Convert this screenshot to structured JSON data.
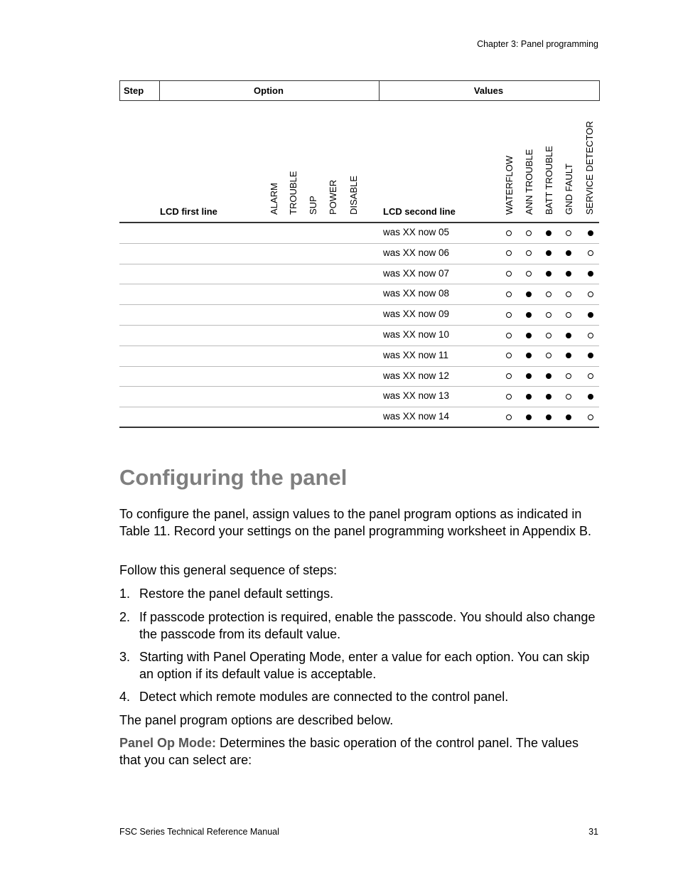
{
  "header": {
    "chapter": "Chapter 3: Panel programming"
  },
  "table": {
    "headers": {
      "step": "Step",
      "option": "Option",
      "values": "Values"
    },
    "subheaders": {
      "lcd_first": "LCD first line",
      "lcd_second": "LCD second line",
      "first_cols": [
        "ALARM",
        "TROUBLE",
        "SUP",
        "POWER",
        "DISABLE"
      ],
      "value_cols": [
        "WATERFLOW",
        "ANN TROUBLE",
        "BATT TROUBLE",
        "GND FAULT",
        "SERVICE DETECTOR"
      ]
    },
    "rows": [
      {
        "lcd2": "was XX now 05",
        "values": [
          0,
          0,
          1,
          0,
          1
        ]
      },
      {
        "lcd2": "was XX now 06",
        "values": [
          0,
          0,
          1,
          1,
          0
        ]
      },
      {
        "lcd2": "was XX now 07",
        "values": [
          0,
          0,
          1,
          1,
          1
        ]
      },
      {
        "lcd2": "was XX now 08",
        "values": [
          0,
          1,
          0,
          0,
          0
        ]
      },
      {
        "lcd2": "was XX now 09",
        "values": [
          0,
          1,
          0,
          0,
          1
        ]
      },
      {
        "lcd2": "was XX now 10",
        "values": [
          0,
          1,
          0,
          1,
          0
        ]
      },
      {
        "lcd2": "was XX now 11",
        "values": [
          0,
          1,
          0,
          1,
          1
        ]
      },
      {
        "lcd2": "was XX now 12",
        "values": [
          0,
          1,
          1,
          0,
          0
        ]
      },
      {
        "lcd2": "was XX now 13",
        "values": [
          0,
          1,
          1,
          0,
          1
        ]
      },
      {
        "lcd2": "was XX now 14",
        "values": [
          0,
          1,
          1,
          1,
          0
        ]
      }
    ]
  },
  "section": {
    "title": "Configuring the panel",
    "intro": "To configure the panel, assign values to the panel program options as indicated in Table 11. Record your settings on the panel programming worksheet in Appendix B.",
    "lead": "Follow this general sequence of steps:",
    "steps": [
      {
        "num": "1.",
        "text": "Restore the panel default settings."
      },
      {
        "num": "2.",
        "text": "If passcode protection is required, enable the passcode. You should also change the passcode from its default value."
      },
      {
        "num": "3.",
        "text": "Starting with Panel Operating Mode, enter a value for each option. You can skip an option if its default value is acceptable."
      },
      {
        "num": "4.",
        "text": "Detect which remote modules are connected to the control panel."
      }
    ],
    "after": "The panel program options are described below.",
    "term": "Panel Op Mode:",
    "term_desc": " Determines the basic operation of the control panel. The values that you can select are:"
  },
  "footer": {
    "manual": "FSC Series Technical Reference Manual",
    "page": "31"
  }
}
